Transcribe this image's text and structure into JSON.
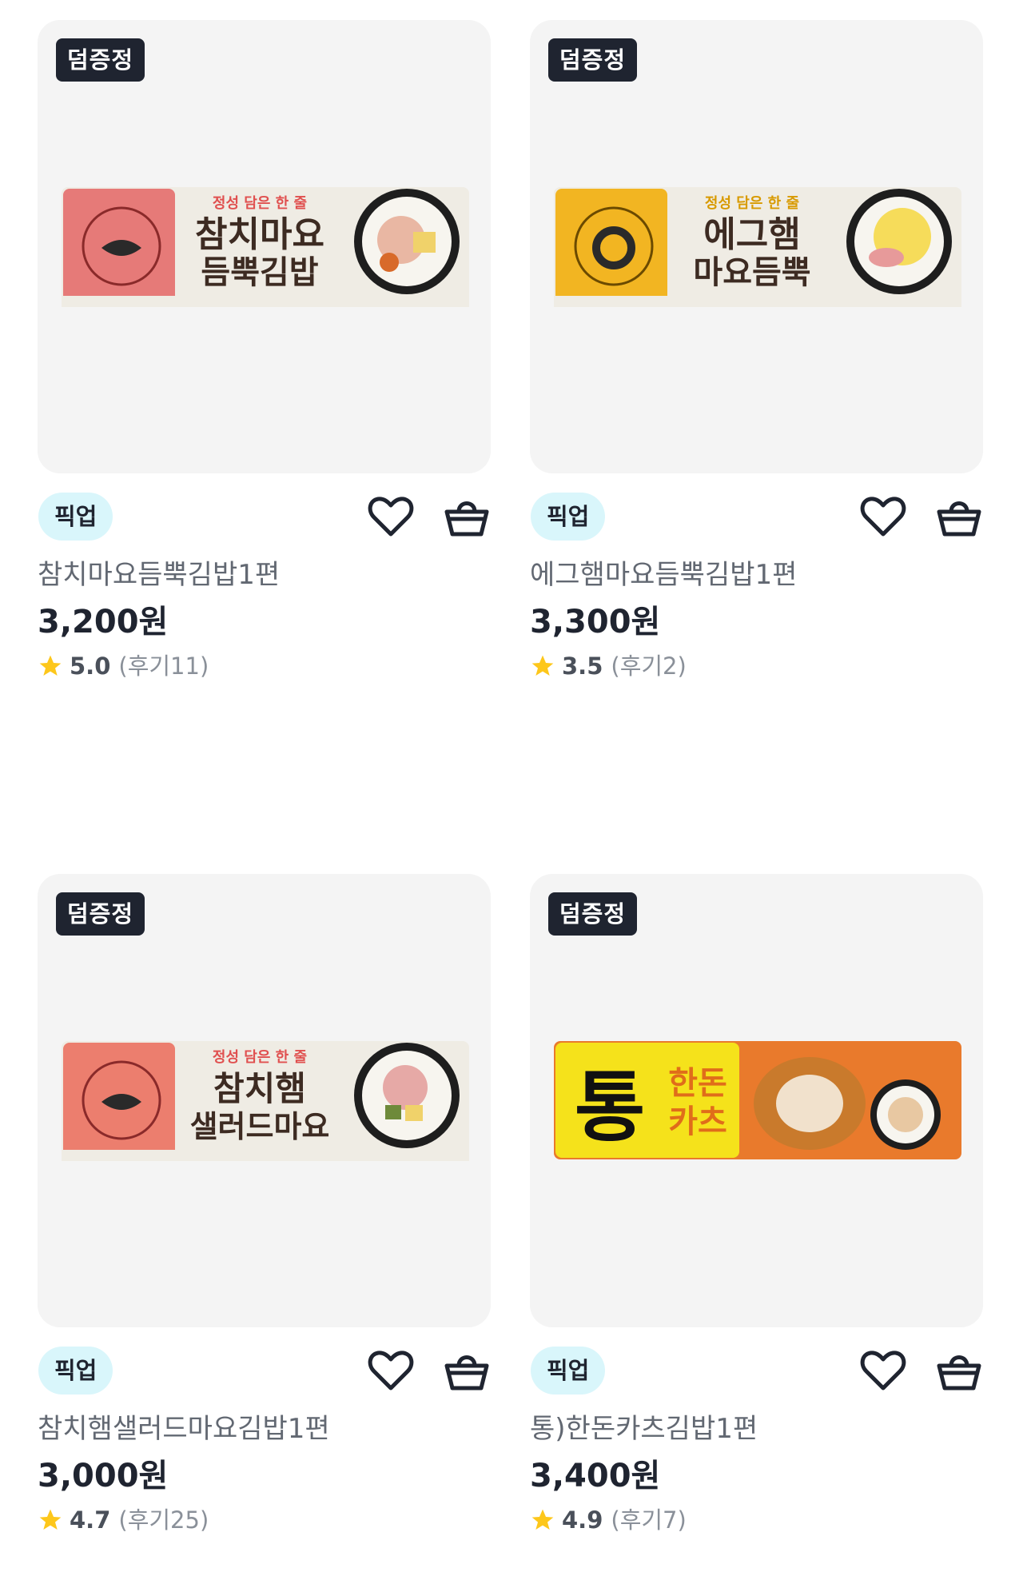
{
  "products": [
    {
      "badge": "덤증정",
      "tag": "픽업",
      "name": "참치마요듬뿍김밥1편",
      "price": "3,200원",
      "score": "5.0",
      "reviews": "(후기11)",
      "wrapper_text_line1": "정성 담은 한 줄",
      "wrapper_text_line2": "참치마요",
      "wrapper_text_line3": "듬뿍김밥",
      "colors": {
        "band": "#e67a78",
        "label": "#b32b38"
      }
    },
    {
      "badge": "덤증정",
      "tag": "픽업",
      "name": "에그햄마요듬뿍김밥1편",
      "price": "3,300원",
      "score": "3.5",
      "reviews": "(후기2)",
      "wrapper_text_line1": "정성 담은 한 줄",
      "wrapper_text_line2": "에그햄",
      "wrapper_text_line3": "마요듬뿍",
      "colors": {
        "band": "#f2b522",
        "label": "#b07a00"
      }
    },
    {
      "badge": "덤증정",
      "tag": "픽업",
      "name": "참치햄샐러드마요김밥1편",
      "price": "3,000원",
      "score": "4.7",
      "reviews": "(후기25)",
      "wrapper_text_line1": "정성 담은 한 줄",
      "wrapper_text_line2": "참치햄",
      "wrapper_text_line3": "샐러드마요",
      "colors": {
        "band": "#ec7e6e",
        "label": "#b32b38"
      }
    },
    {
      "badge": "덤증정",
      "tag": "픽업",
      "name": "통)한돈카츠김밥1편",
      "price": "3,400원",
      "score": "4.9",
      "reviews": "(후기7)",
      "wrapper_text_line1": "통",
      "wrapper_text_line2": "한돈",
      "wrapper_text_line3": "카츠",
      "colors": {
        "band": "#f5e21b",
        "label": "#e06d1a"
      }
    }
  ],
  "icons": {
    "star": "star-icon",
    "heart": "heart-icon",
    "cart": "basket-icon"
  },
  "colors": {
    "star": "#fdc71b",
    "badge_bg": "#1f2430",
    "pickup_bg": "#d9f6fb"
  }
}
